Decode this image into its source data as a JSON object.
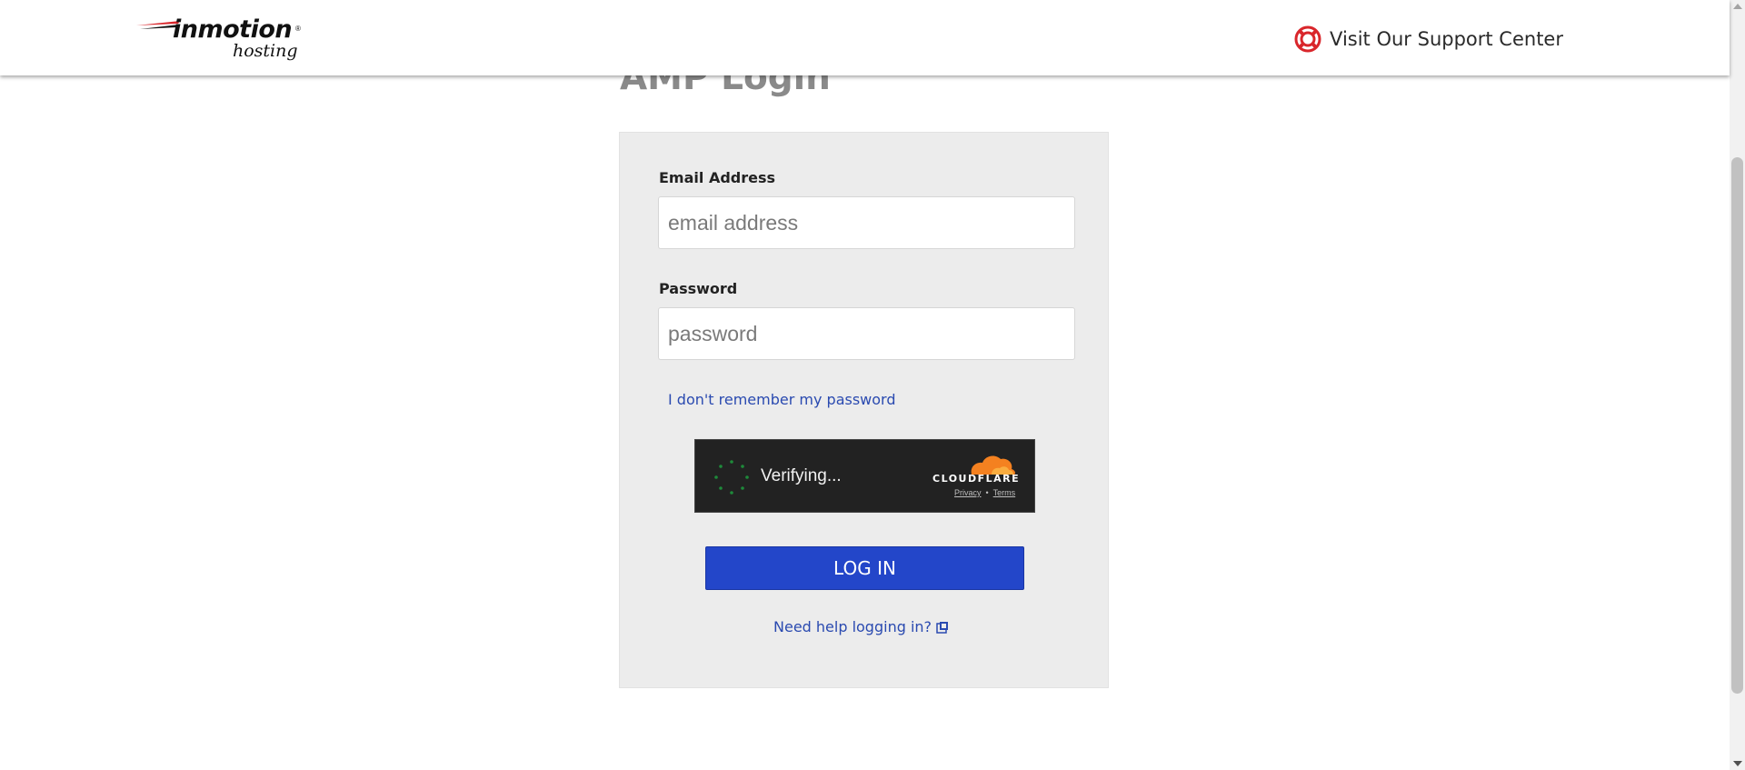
{
  "header": {
    "logo_main": "inmotion",
    "logo_sub": "hosting",
    "logo_reg": "®",
    "support_label": "Visit Our Support Center",
    "support_icon": "lifebuoy-icon"
  },
  "page": {
    "title": "AMP Login"
  },
  "form": {
    "email_label": "Email Address",
    "email_placeholder": "email address",
    "email_value": "",
    "password_label": "Password",
    "password_placeholder": "password",
    "password_value": "",
    "forgot_link": "I don't remember my password",
    "login_button": "LOG IN",
    "help_link": "Need help logging in?"
  },
  "turnstile": {
    "status": "Verifying...",
    "brand": "CLOUDFLARE",
    "privacy": "Privacy",
    "separator": "•",
    "terms": "Terms"
  },
  "colors": {
    "accent": "#2346c9",
    "link": "#2a4ab0",
    "card_bg": "#ececec",
    "support_icon": "#d9262b",
    "cloudflare_orange": "#f48120"
  }
}
